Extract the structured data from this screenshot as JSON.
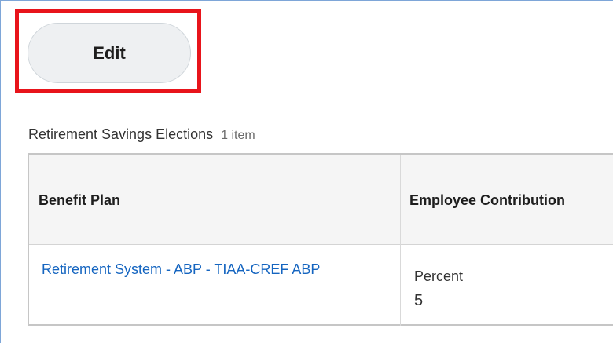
{
  "toolbar": {
    "edit_label": "Edit"
  },
  "section": {
    "title": "Retirement Savings Elections",
    "count": "1 item"
  },
  "table": {
    "columns": [
      "Benefit Plan",
      "Employee Contribution"
    ],
    "rows": [
      {
        "benefit_plan": "Retirement System - ABP - TIAA-CREF ABP",
        "contribution_type": "Percent",
        "contribution_value": "5"
      }
    ]
  },
  "colors": {
    "highlight": "#e8141b",
    "link": "#1565c0",
    "header_bg": "#f5f5f5",
    "button_bg": "#eef0f2"
  }
}
